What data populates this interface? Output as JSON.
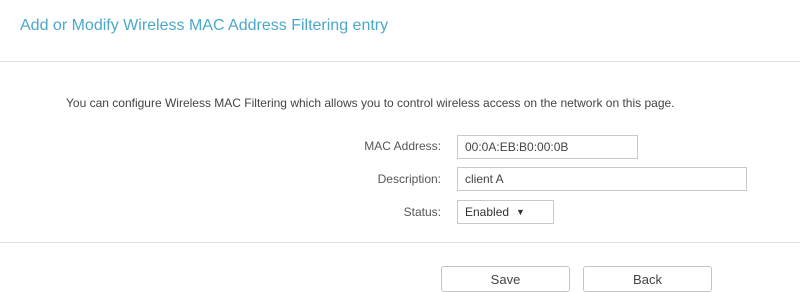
{
  "header": {
    "title": "Add or Modify Wireless MAC Address Filtering entry"
  },
  "intro_text": "You can configure Wireless MAC Filtering which allows you to control wireless access on the network on this page.",
  "form": {
    "mac_address": {
      "label": "MAC Address:",
      "value": "00:0A:EB:B0:00:0B"
    },
    "description": {
      "label": "Description:",
      "value": "client A"
    },
    "status": {
      "label": "Status:",
      "selected": "Enabled",
      "icon": "chevron-down-icon"
    }
  },
  "buttons": {
    "save_label": "Save",
    "back_label": "Back"
  },
  "colors": {
    "title": "#4aa9c8",
    "divider": "#e1e1e1",
    "field_border": "#c9c9c9"
  }
}
